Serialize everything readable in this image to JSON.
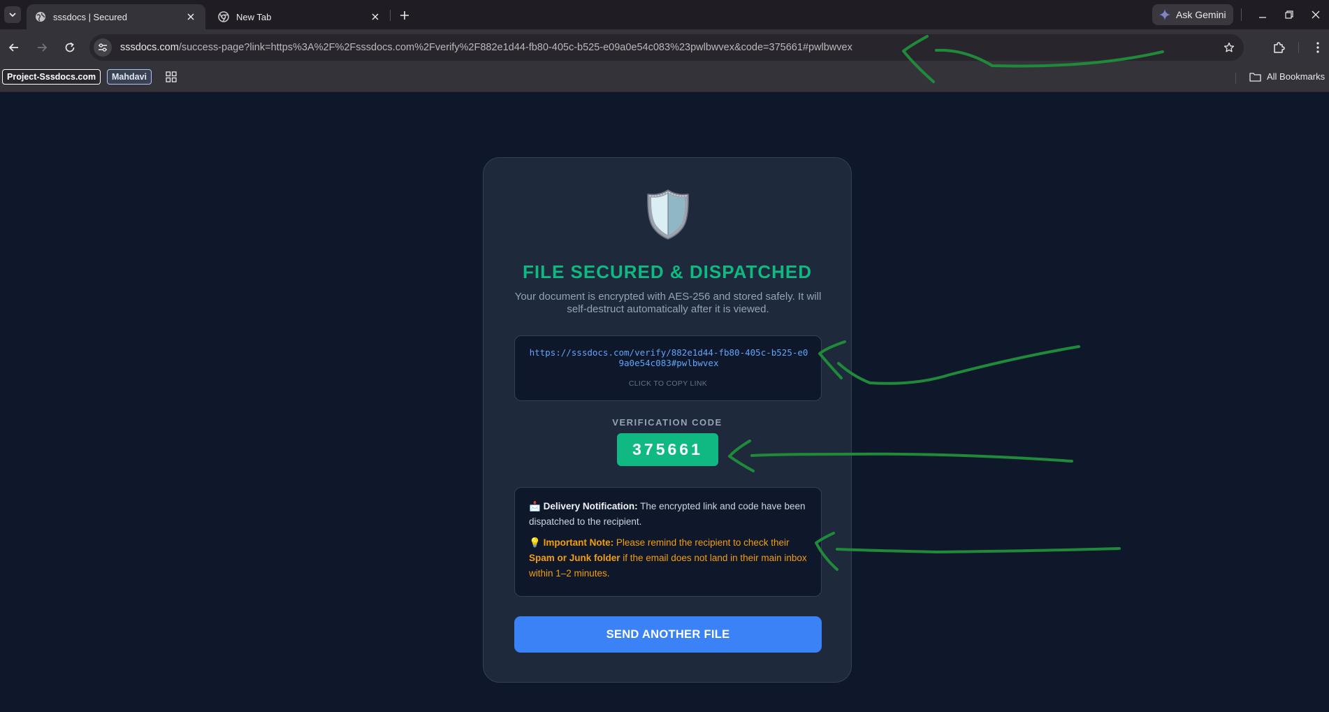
{
  "browser": {
    "tabs": [
      {
        "title": "sssdocs | Secured",
        "active": true,
        "icon": "globe-icon"
      },
      {
        "title": "New Tab",
        "active": false,
        "icon": "chrome-icon"
      }
    ],
    "ask_gemini_label": "Ask Gemini",
    "url": {
      "host": "sssdocs.com",
      "path": "/success-page?link=https%3A%2F%2Fsssdocs.com%2Fverify%2F882e1d44-fb80-405c-b525-e09a0e54c083%23pwlbwvex&code=375661#pwlbwvex"
    },
    "bookmarks": [
      {
        "label": "Project-Sssdocs.com"
      },
      {
        "label": "Mahdavi"
      }
    ],
    "all_bookmarks_label": "All Bookmarks"
  },
  "card": {
    "icon": "shield-icon",
    "title": "FILE SECURED & DISPATCHED",
    "subtitle": "Your document is encrypted with AES-256 and stored safely. It will self-destruct automatically after it is viewed.",
    "link_url": "https://sssdocs.com/verify/882e1d44-fb80-405c-b525-e09a0e54c083#pwlbwvex",
    "copy_hint": "CLICK TO COPY LINK",
    "verification_label": "VERIFICATION CODE",
    "verification_code": "375661",
    "delivery": {
      "emoji": "📩",
      "label": "Delivery Notification:",
      "text": " The encrypted link and code have been dispatched to the recipient."
    },
    "important": {
      "emoji": "💡",
      "label": "Important Note:",
      "text_before": " Please remind the recipient to check their ",
      "highlight": "Spam or Junk folder",
      "text_after": " if the email does not land in their main inbox within 1–2 minutes."
    },
    "send_button_label": "SEND ANOTHER FILE"
  },
  "colors": {
    "page_bg": "#0f172a",
    "card_bg": "#1e293b",
    "success_green": "#10b981",
    "link_blue": "#60a5fa",
    "warning_amber": "#f59e0b",
    "button_blue": "#3b82f6",
    "annotation_green": "#1f8a3a"
  }
}
